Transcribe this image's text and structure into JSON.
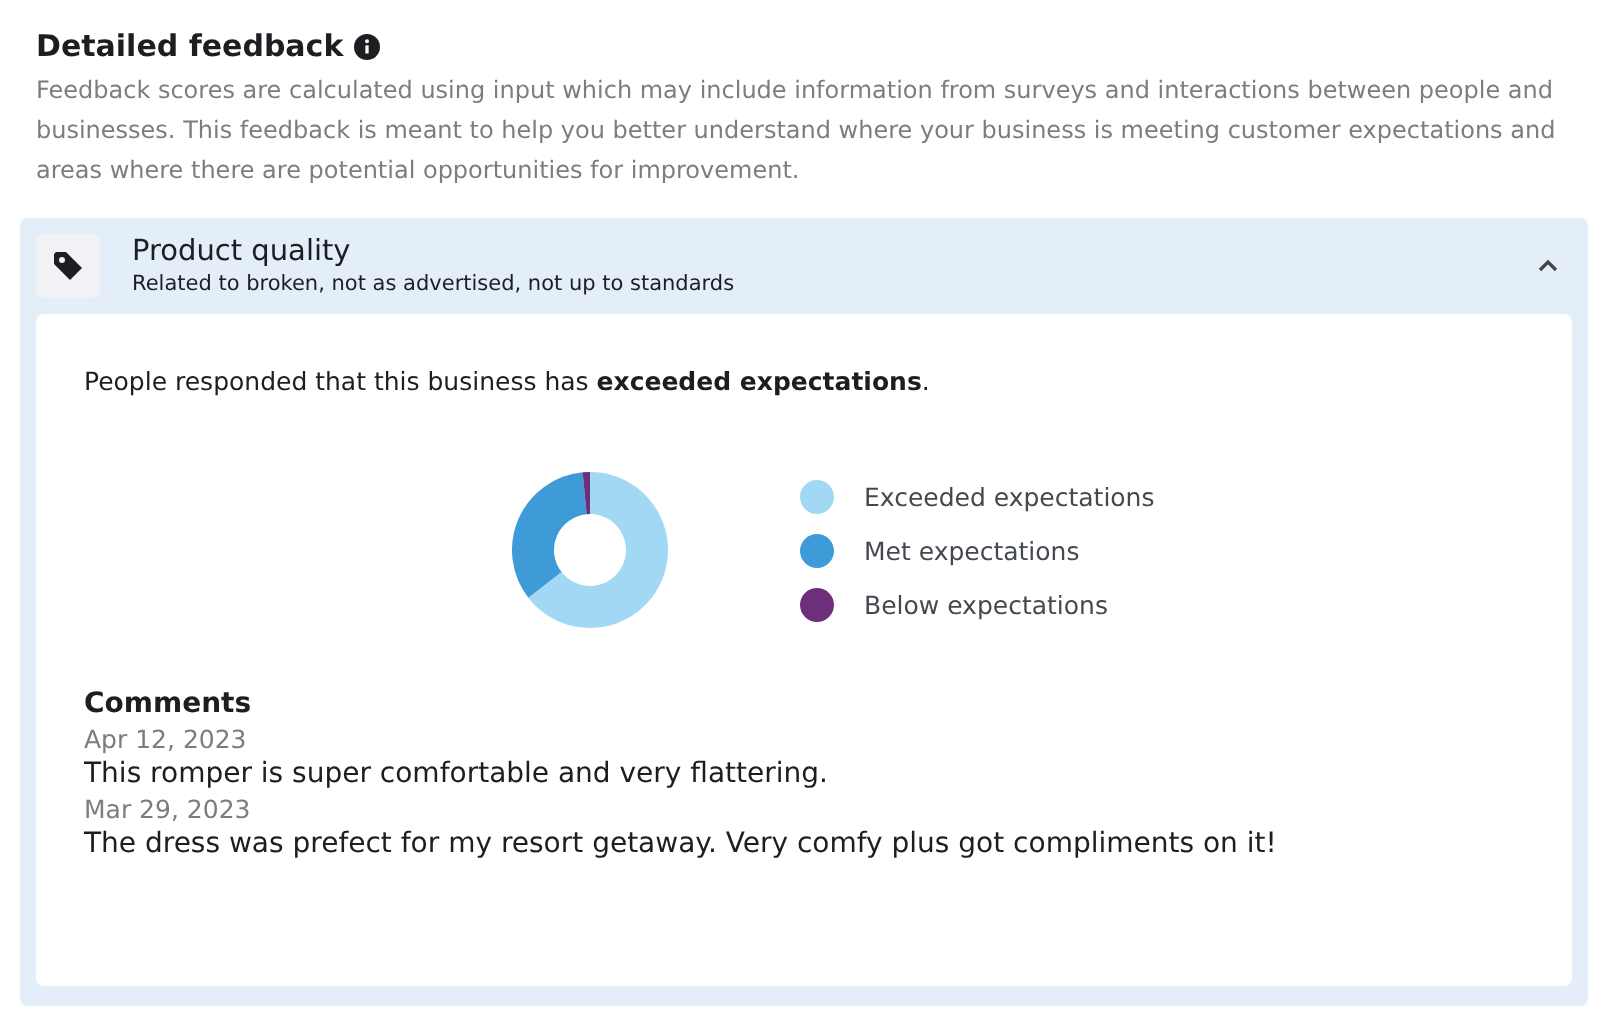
{
  "section": {
    "title": "Detailed feedback",
    "description": "Feedback scores are calculated using input which may include information from surveys and interactions between people and businesses. This feedback is meant to help you better understand where your business is meeting customer expectations and areas where there are potential opportunities for improvement."
  },
  "category": {
    "title": "Product quality",
    "subtitle": "Related to broken, not as advertised, not up to standards",
    "expanded": true,
    "summary": "People responded that this business has **exceeded expectations**.",
    "legend": [
      {
        "label": "Exceeded expectations",
        "color": "#a3d8f5"
      },
      {
        "label": "Met expectations",
        "color": "#3f9ad8"
      },
      {
        "label": "Below expectations",
        "color": "#6e2f7a"
      }
    ],
    "comments_title": "Comments",
    "comments": [
      {
        "date": "Apr 12, 2023",
        "text": "This romper is super comfortable and very flattering."
      },
      {
        "date": "Mar 29, 2023",
        "text": "The dress was prefect for my resort getaway. Very comfy plus got compliments on it!"
      }
    ]
  }
}
